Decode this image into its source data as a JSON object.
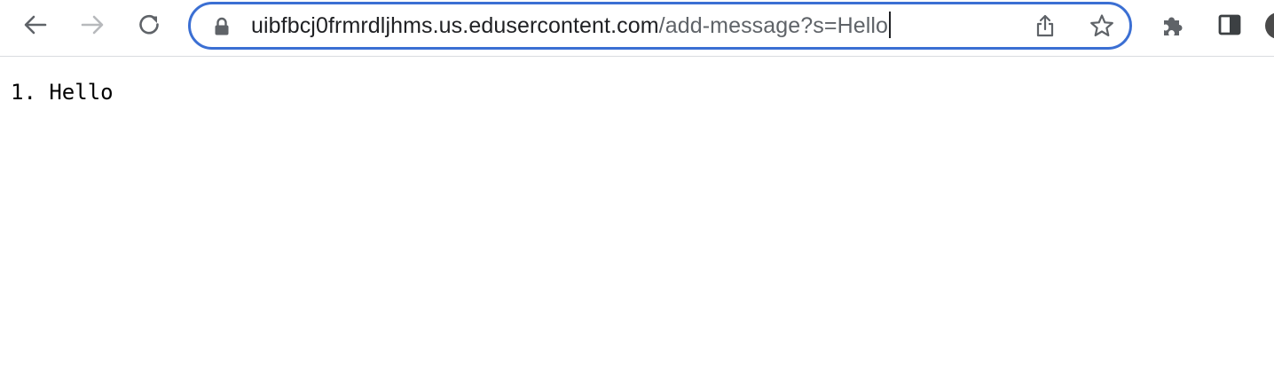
{
  "browser": {
    "icons": {
      "back": "arrow-left-icon",
      "forward": "arrow-right-icon",
      "reload": "reload-icon",
      "lock": "lock-icon",
      "share": "share-icon",
      "bookmark": "star-icon",
      "extensions": "puzzle-icon",
      "side_panel": "side-panel-icon"
    },
    "address_bar": {
      "host": "uibfbcj0frmrdljhms.us.edusercontent.com",
      "path": "/add-message?s=Hello",
      "focus_ring_color": "#3b6fd3"
    }
  },
  "page": {
    "messages": [
      {
        "number": "1.",
        "text": "Hello"
      }
    ]
  }
}
